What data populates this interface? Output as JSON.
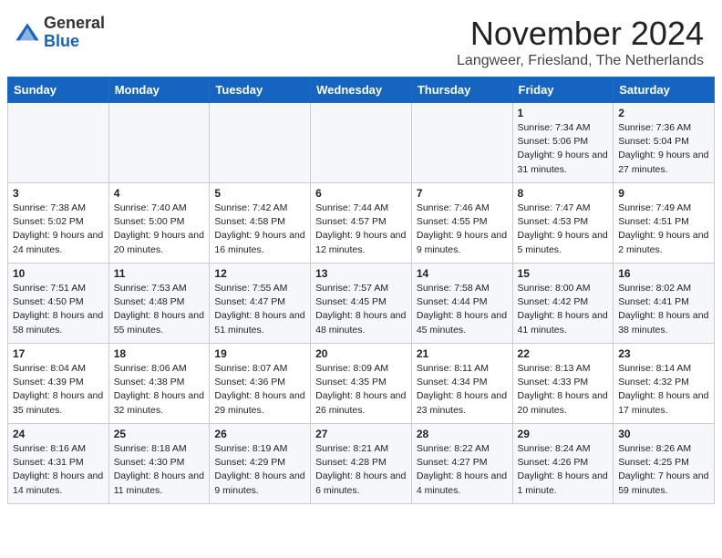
{
  "logo": {
    "general": "General",
    "blue": "Blue"
  },
  "title": "November 2024",
  "location": "Langweer, Friesland, The Netherlands",
  "days_of_week": [
    "Sunday",
    "Monday",
    "Tuesday",
    "Wednesday",
    "Thursday",
    "Friday",
    "Saturday"
  ],
  "weeks": [
    [
      {
        "day": "",
        "info": ""
      },
      {
        "day": "",
        "info": ""
      },
      {
        "day": "",
        "info": ""
      },
      {
        "day": "",
        "info": ""
      },
      {
        "day": "",
        "info": ""
      },
      {
        "day": "1",
        "info": "Sunrise: 7:34 AM\nSunset: 5:06 PM\nDaylight: 9 hours and 31 minutes."
      },
      {
        "day": "2",
        "info": "Sunrise: 7:36 AM\nSunset: 5:04 PM\nDaylight: 9 hours and 27 minutes."
      }
    ],
    [
      {
        "day": "3",
        "info": "Sunrise: 7:38 AM\nSunset: 5:02 PM\nDaylight: 9 hours and 24 minutes."
      },
      {
        "day": "4",
        "info": "Sunrise: 7:40 AM\nSunset: 5:00 PM\nDaylight: 9 hours and 20 minutes."
      },
      {
        "day": "5",
        "info": "Sunrise: 7:42 AM\nSunset: 4:58 PM\nDaylight: 9 hours and 16 minutes."
      },
      {
        "day": "6",
        "info": "Sunrise: 7:44 AM\nSunset: 4:57 PM\nDaylight: 9 hours and 12 minutes."
      },
      {
        "day": "7",
        "info": "Sunrise: 7:46 AM\nSunset: 4:55 PM\nDaylight: 9 hours and 9 minutes."
      },
      {
        "day": "8",
        "info": "Sunrise: 7:47 AM\nSunset: 4:53 PM\nDaylight: 9 hours and 5 minutes."
      },
      {
        "day": "9",
        "info": "Sunrise: 7:49 AM\nSunset: 4:51 PM\nDaylight: 9 hours and 2 minutes."
      }
    ],
    [
      {
        "day": "10",
        "info": "Sunrise: 7:51 AM\nSunset: 4:50 PM\nDaylight: 8 hours and 58 minutes."
      },
      {
        "day": "11",
        "info": "Sunrise: 7:53 AM\nSunset: 4:48 PM\nDaylight: 8 hours and 55 minutes."
      },
      {
        "day": "12",
        "info": "Sunrise: 7:55 AM\nSunset: 4:47 PM\nDaylight: 8 hours and 51 minutes."
      },
      {
        "day": "13",
        "info": "Sunrise: 7:57 AM\nSunset: 4:45 PM\nDaylight: 8 hours and 48 minutes."
      },
      {
        "day": "14",
        "info": "Sunrise: 7:58 AM\nSunset: 4:44 PM\nDaylight: 8 hours and 45 minutes."
      },
      {
        "day": "15",
        "info": "Sunrise: 8:00 AM\nSunset: 4:42 PM\nDaylight: 8 hours and 41 minutes."
      },
      {
        "day": "16",
        "info": "Sunrise: 8:02 AM\nSunset: 4:41 PM\nDaylight: 8 hours and 38 minutes."
      }
    ],
    [
      {
        "day": "17",
        "info": "Sunrise: 8:04 AM\nSunset: 4:39 PM\nDaylight: 8 hours and 35 minutes."
      },
      {
        "day": "18",
        "info": "Sunrise: 8:06 AM\nSunset: 4:38 PM\nDaylight: 8 hours and 32 minutes."
      },
      {
        "day": "19",
        "info": "Sunrise: 8:07 AM\nSunset: 4:36 PM\nDaylight: 8 hours and 29 minutes."
      },
      {
        "day": "20",
        "info": "Sunrise: 8:09 AM\nSunset: 4:35 PM\nDaylight: 8 hours and 26 minutes."
      },
      {
        "day": "21",
        "info": "Sunrise: 8:11 AM\nSunset: 4:34 PM\nDaylight: 8 hours and 23 minutes."
      },
      {
        "day": "22",
        "info": "Sunrise: 8:13 AM\nSunset: 4:33 PM\nDaylight: 8 hours and 20 minutes."
      },
      {
        "day": "23",
        "info": "Sunrise: 8:14 AM\nSunset: 4:32 PM\nDaylight: 8 hours and 17 minutes."
      }
    ],
    [
      {
        "day": "24",
        "info": "Sunrise: 8:16 AM\nSunset: 4:31 PM\nDaylight: 8 hours and 14 minutes."
      },
      {
        "day": "25",
        "info": "Sunrise: 8:18 AM\nSunset: 4:30 PM\nDaylight: 8 hours and 11 minutes."
      },
      {
        "day": "26",
        "info": "Sunrise: 8:19 AM\nSunset: 4:29 PM\nDaylight: 8 hours and 9 minutes."
      },
      {
        "day": "27",
        "info": "Sunrise: 8:21 AM\nSunset: 4:28 PM\nDaylight: 8 hours and 6 minutes."
      },
      {
        "day": "28",
        "info": "Sunrise: 8:22 AM\nSunset: 4:27 PM\nDaylight: 8 hours and 4 minutes."
      },
      {
        "day": "29",
        "info": "Sunrise: 8:24 AM\nSunset: 4:26 PM\nDaylight: 8 hours and 1 minute."
      },
      {
        "day": "30",
        "info": "Sunrise: 8:26 AM\nSunset: 4:25 PM\nDaylight: 7 hours and 59 minutes."
      }
    ]
  ]
}
